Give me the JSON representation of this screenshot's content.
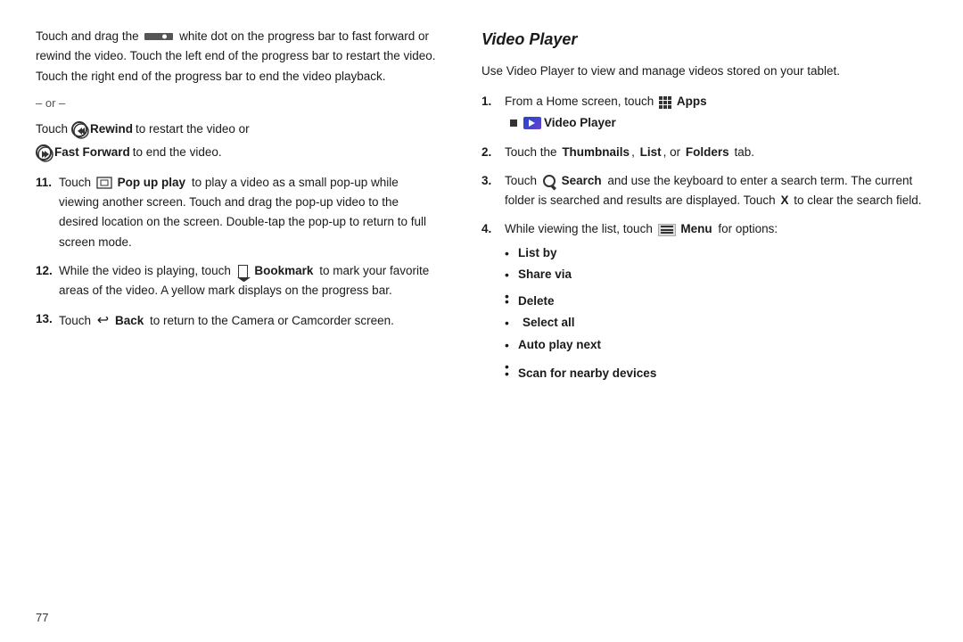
{
  "left": {
    "intro": "Touch and drag the",
    "intro2": "white dot on the progress bar to fast forward or rewind the video. Touch the left end of the progress bar to restart the video. Touch the right end of the progress bar to end the video playback.",
    "or_divider": "– or –",
    "rewind_line": "Touch",
    "rewind_label": "Rewind",
    "rewind_suffix": "to restart the video or",
    "ff_label": "Fast Forward",
    "ff_suffix": "to end the video.",
    "items": [
      {
        "num": "11.",
        "text_before": "Touch",
        "icon": "popup",
        "label": "Pop up play",
        "text_after": "to play a video as a small pop-up while viewing another screen. Touch and drag the pop-up video to the desired location on the screen. Double-tap the pop-up to return to full screen mode."
      },
      {
        "num": "12.",
        "text_before": "While the video is playing, touch",
        "icon": "bookmark",
        "label": "Bookmark",
        "text_after": "to mark your favorite areas of the video. A yellow mark displays on the progress bar."
      },
      {
        "num": "13.",
        "text_before": "Touch",
        "icon": "back",
        "label": "Back",
        "text_after": "to return to the Camera or Camcorder screen."
      }
    ]
  },
  "right": {
    "title": "Video Player",
    "intro": "Use Video Player to view and manage videos stored on your tablet.",
    "items": [
      {
        "num": "1.",
        "text": "From a Home screen, touch",
        "apps_label": "Apps",
        "sub_label": "Video Player",
        "icon": "apps"
      },
      {
        "num": "2.",
        "text_before": "Touch the",
        "labels": [
          "Thumbnails",
          "List",
          "or",
          "Folders"
        ],
        "text_after": "tab."
      },
      {
        "num": "3.",
        "text_before": "Touch",
        "search_label": "Search",
        "text_after": "and use the keyboard to enter a search term. The current folder is searched and results are displayed. Touch",
        "x_label": "X",
        "text_end": "to clear the search field."
      },
      {
        "num": "4.",
        "text_before": "While viewing the list, touch",
        "menu_label": "Menu",
        "text_after": "for options:"
      }
    ],
    "bullet_items": [
      {
        "label": "List by"
      },
      {
        "label": "Share via"
      },
      {
        "label": "Delete"
      },
      {
        "label": "Select all",
        "no_bullet": true
      },
      {
        "label": "Auto play next"
      },
      {
        "label": "Scan for nearby devices"
      }
    ]
  },
  "page_number": "77"
}
